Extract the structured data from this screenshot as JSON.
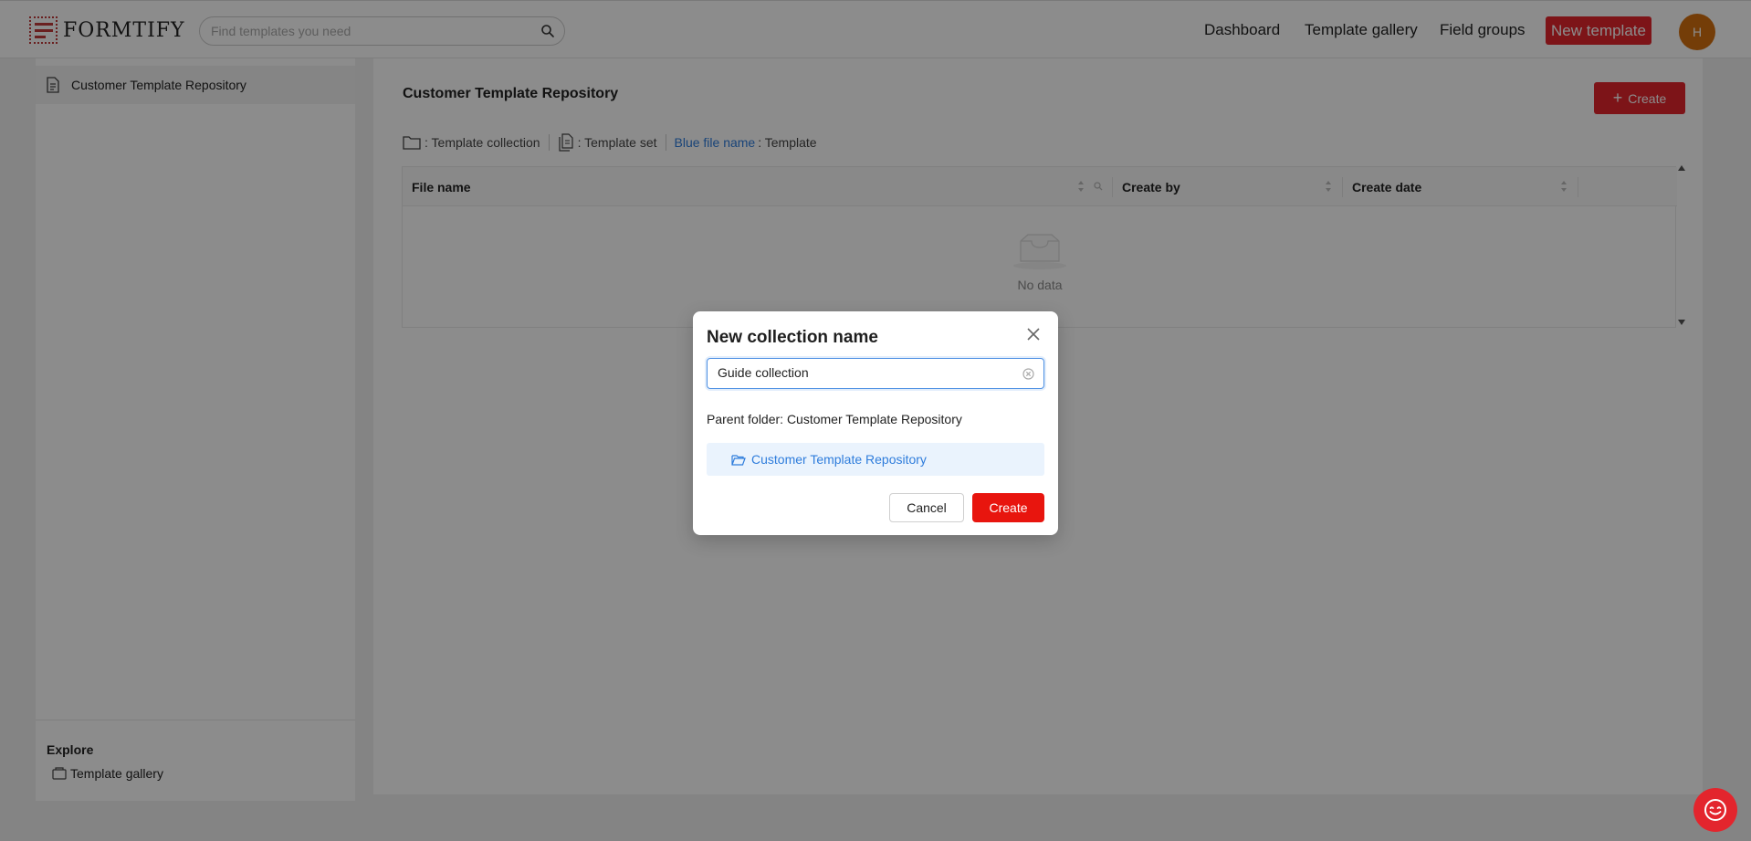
{
  "header": {
    "logo_text": "FORMTIFY",
    "search_placeholder": "Find templates you need",
    "nav": [
      "Dashboard",
      "Template gallery",
      "Field groups"
    ],
    "new_template_label": "New template",
    "avatar_initial": "H"
  },
  "sidebar": {
    "items": [
      {
        "label": "Customer Template Repository"
      }
    ],
    "explore_title": "Explore",
    "explore_items": [
      {
        "label": "Template gallery"
      }
    ]
  },
  "main": {
    "title": "Customer Template Repository",
    "create_label": "Create",
    "legend": {
      "collection": ": Template collection",
      "set": ": Template set",
      "blue_file": "Blue file name",
      "template": ": Template"
    },
    "table": {
      "columns": [
        "File name",
        "Create by",
        "Create date"
      ],
      "empty_text": "No data"
    }
  },
  "modal": {
    "title": "New collection name",
    "input_value": "Guide collection",
    "parent_folder_label": "Parent folder: Customer Template Repository",
    "tree_item": "Customer Template Repository",
    "cancel_label": "Cancel",
    "create_label": "Create"
  },
  "colors": {
    "brand_red": "#e3252d",
    "link_blue": "#2f7ddc",
    "avatar": "#d4700f"
  }
}
